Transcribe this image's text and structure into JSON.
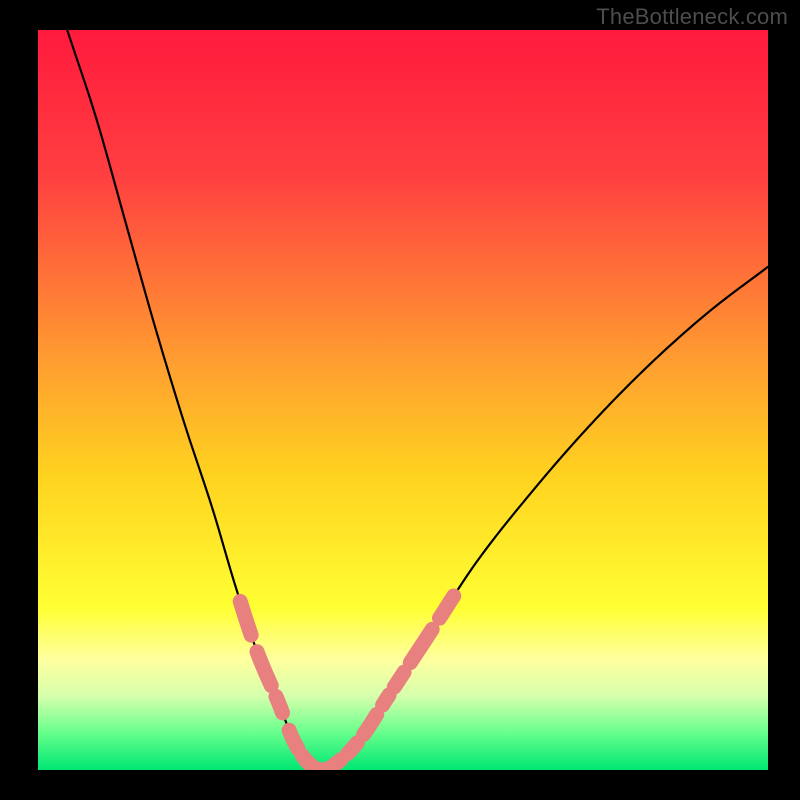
{
  "watermark": "TheBottleneck.com",
  "chart_data": {
    "type": "line",
    "title": "",
    "xlabel": "",
    "ylabel": "",
    "xlim": [
      0,
      100
    ],
    "ylim": [
      0,
      100
    ],
    "grid": false,
    "legend": false,
    "gradient_stops": [
      {
        "offset": 0.0,
        "color": "#ff1a3d"
      },
      {
        "offset": 0.2,
        "color": "#ff4040"
      },
      {
        "offset": 0.45,
        "color": "#ff9e30"
      },
      {
        "offset": 0.6,
        "color": "#ffd21f"
      },
      {
        "offset": 0.78,
        "color": "#ffff33"
      },
      {
        "offset": 0.85,
        "color": "#ffff9e"
      },
      {
        "offset": 0.9,
        "color": "#d6ffac"
      },
      {
        "offset": 0.95,
        "color": "#66ff8c"
      },
      {
        "offset": 1.0,
        "color": "#00e673"
      }
    ],
    "series": [
      {
        "name": "bottleneck-curve",
        "x": [
          4,
          8,
          12,
          16,
          20,
          24,
          27,
          30,
          33,
          35,
          37,
          39,
          41,
          44,
          48,
          54,
          60,
          68,
          76,
          84,
          92,
          100
        ],
        "y": [
          100,
          88,
          74,
          60,
          47,
          35,
          25,
          16,
          9,
          4,
          1,
          0,
          1,
          4,
          10,
          19,
          28,
          38,
          47,
          55,
          62,
          68
        ]
      }
    ],
    "marker_ranges": [
      {
        "side": "left",
        "x_start": 27.7,
        "x_end": 29.3
      },
      {
        "side": "left",
        "x_start": 30.0,
        "x_end": 32.0
      },
      {
        "side": "left",
        "x_start": 32.6,
        "x_end": 33.6
      },
      {
        "side": "left",
        "x_start": 34.4,
        "x_end": 35.6
      },
      {
        "side": "left",
        "x_start": 36.2,
        "x_end": 37.7
      },
      {
        "side": "left",
        "x_start": 38.3,
        "x_end": 40.0
      },
      {
        "side": "right",
        "x_start": 40.6,
        "x_end": 41.6
      },
      {
        "side": "right",
        "x_start": 42.4,
        "x_end": 43.8
      },
      {
        "side": "right",
        "x_start": 44.6,
        "x_end": 46.4
      },
      {
        "side": "right",
        "x_start": 47.2,
        "x_end": 48.2
      },
      {
        "side": "right",
        "x_start": 48.8,
        "x_end": 50.2
      },
      {
        "side": "right",
        "x_start": 51.0,
        "x_end": 54.0
      },
      {
        "side": "right",
        "x_start": 55.0,
        "x_end": 57.0
      }
    ]
  }
}
